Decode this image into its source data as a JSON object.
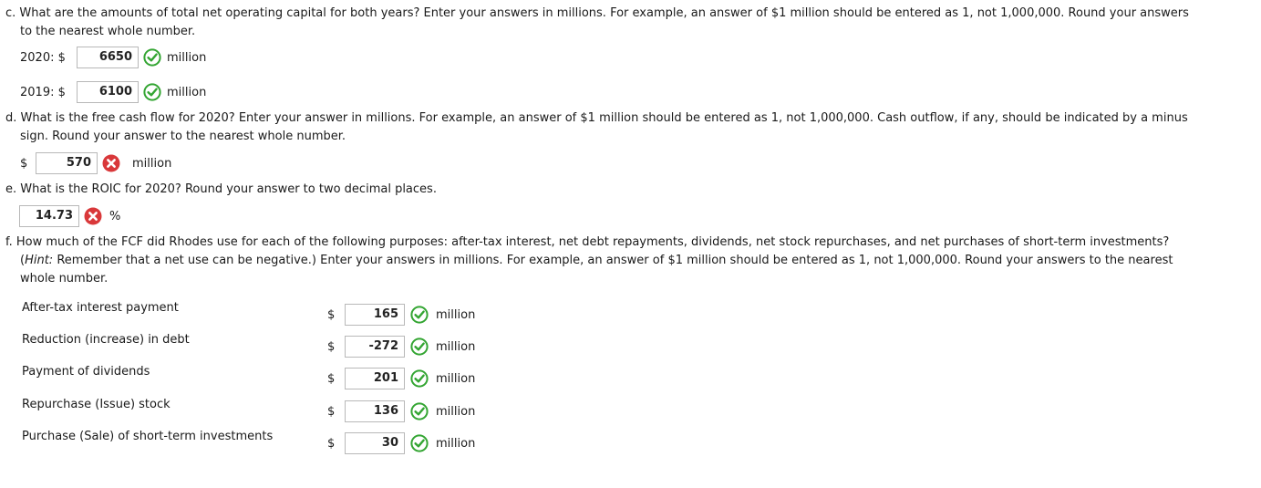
{
  "c": {
    "question_line1": "c. What are the amounts of total net operating capital for both years? Enter your answers in millions. For example, an answer of $1 million should be entered as 1, not 1,000,000. Round your answers",
    "question_line2": "to the nearest whole number.",
    "rows": [
      {
        "label": "2020: $",
        "value": "6650",
        "unit": "million",
        "status": "correct"
      },
      {
        "label": "2019: $",
        "value": "6100",
        "unit": "million",
        "status": "correct"
      }
    ]
  },
  "d": {
    "question_line1": "d. What is the free cash flow for 2020? Enter your answer in millions. For example, an answer of $1 million should be entered as 1, not 1,000,000. Cash outflow, if any, should be indicated by a minus",
    "question_line2": "sign. Round your answer to the nearest whole number.",
    "currency": "$",
    "value": "570",
    "unit": "million",
    "status": "incorrect"
  },
  "e": {
    "question": "e. What is the ROIC for 2020? Round your answer to two decimal places.",
    "value": "14.73",
    "unit": "%",
    "status": "incorrect"
  },
  "f": {
    "question_line1": "f. How much of the FCF did Rhodes use for each of the following purposes: after-tax interest, net debt repayments, dividends, net stock repurchases, and net purchases of short-term investments?",
    "hint_open": "(",
    "hint_label": "Hint:",
    "hint_rest": " Remember that a net use can be negative.) Enter your answers in millions. For example, an answer of $1 million should be entered as 1, not 1,000,000. Round your answers to the nearest",
    "question_line3": "whole number.",
    "rows": [
      {
        "label": "After-tax interest payment",
        "currency": "$",
        "value": "165",
        "unit": "million",
        "status": "correct"
      },
      {
        "label": "Reduction (increase) in debt",
        "currency": "$",
        "value": "-272",
        "unit": "million",
        "status": "correct"
      },
      {
        "label": "Payment of dividends",
        "currency": "$",
        "value": "201",
        "unit": "million",
        "status": "correct"
      },
      {
        "label": "Repurchase (Issue) stock",
        "currency": "$",
        "value": "136",
        "unit": "million",
        "status": "correct"
      },
      {
        "label": "Purchase (Sale) of short-term investments",
        "currency": "$",
        "value": "30",
        "unit": "million",
        "status": "correct"
      }
    ]
  },
  "colors": {
    "correct": "#33a532",
    "incorrect": "#d9383a"
  },
  "icons": {
    "correct": "check-circle-icon",
    "incorrect": "x-circle-icon"
  }
}
